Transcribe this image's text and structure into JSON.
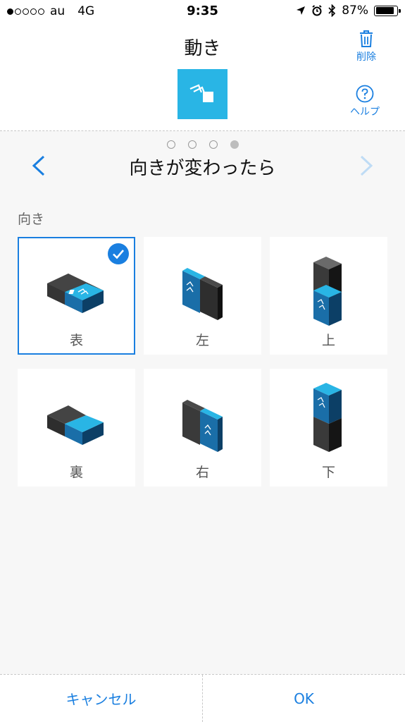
{
  "status_bar": {
    "carrier": "au",
    "network": "4G",
    "time": "9:35",
    "battery_percent_label": "87%",
    "battery_level": 0.87,
    "signal_bars_filled": 1,
    "signal_bars_total": 5
  },
  "header": {
    "title": "動き",
    "delete_label": "削除",
    "help_label": "ヘルプ",
    "accent_color": "#29b5e5"
  },
  "pager": {
    "page_count": 4,
    "current_page": 4,
    "step_title": "向きが変わったら"
  },
  "section": {
    "label": "向き"
  },
  "orientations": [
    {
      "label": "表",
      "selected": true,
      "icon": "block-face-up-icon"
    },
    {
      "label": "左",
      "selected": false,
      "icon": "block-left-icon"
    },
    {
      "label": "上",
      "selected": false,
      "icon": "block-top-icon"
    },
    {
      "label": "裏",
      "selected": false,
      "icon": "block-face-down-icon"
    },
    {
      "label": "右",
      "selected": false,
      "icon": "block-right-icon"
    },
    {
      "label": "下",
      "selected": false,
      "icon": "block-bottom-icon"
    }
  ],
  "footer": {
    "cancel_label": "キャンセル",
    "ok_label": "OK"
  },
  "colors": {
    "link_blue": "#1a7fe0",
    "block_blue": "#29b5e5",
    "block_dark": "#3a3a3a"
  }
}
